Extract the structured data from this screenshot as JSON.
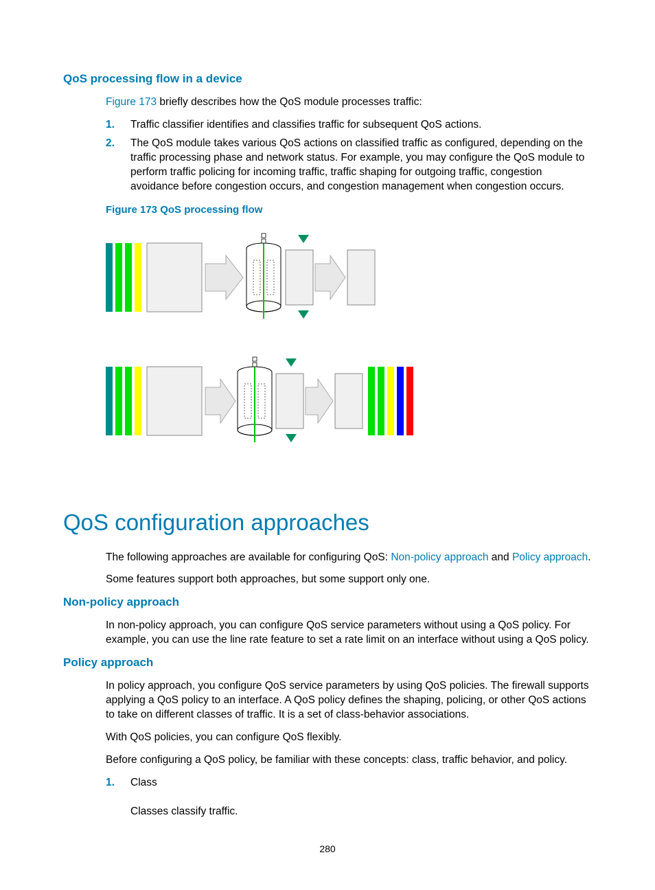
{
  "section1": {
    "heading": "QoS processing flow in a device",
    "intro_pre": " briefly describes how the QoS module processes traffic:",
    "fig_link": "Figure 173",
    "li1": "Traffic classifier identifies and classifies traffic for subsequent QoS actions.",
    "li2": "The QoS module takes various QoS actions on classified traffic as configured, depending on the traffic processing phase and network status. For example, you may configure the QoS module to perform traffic policing for incoming traffic, traffic shaping for outgoing traffic, congestion avoidance before congestion occurs, and congestion management when congestion occurs.",
    "fig_caption": "Figure 173 QoS processing flow"
  },
  "section2": {
    "heading": "QoS configuration approaches",
    "intro_a": "The following approaches are available for configuring QoS: ",
    "link1": "Non-policy approach",
    "intro_b": " and ",
    "link2": "Policy approach",
    "intro_c": ".",
    "p2": "Some features support both approaches, but some support only one."
  },
  "section3": {
    "heading": "Non-policy approach",
    "p1": "In non-policy approach, you can configure QoS service parameters without using a QoS policy. For example, you can use the line rate feature to set a rate limit on an interface without using a QoS policy."
  },
  "section4": {
    "heading": "Policy approach",
    "p1": "In policy approach, you configure QoS service parameters by using QoS policies. The firewall supports applying a QoS policy to an interface. A QoS policy defines the shaping, policing, or other QoS actions to take on different classes of traffic. It is a set of class-behavior associations.",
    "p2": "With QoS policies, you can configure QoS flexibly.",
    "p3": "Before configuring a QoS policy, be familiar with these concepts: class, traffic behavior, and policy.",
    "li1": "Class",
    "li1b": "Classes classify traffic."
  },
  "nums": {
    "n1": "1.",
    "n2": "2."
  },
  "page_num": "280",
  "colors": {
    "accent": "#007cb0",
    "bar_teal": "#008c8c",
    "bar_green": "#00e000",
    "bar_yellow": "#ffff00",
    "bar_red": "#ff0000",
    "bar_blue": "#0000ff"
  },
  "chart_data": {
    "type": "diagram",
    "description": "Two flow diagrams. Each shows colored input traffic bars (teal, green, green, yellow) entering a processing box, then an arrow to a cylindrical classifier/queue with green downward flow and triangle markers, then an arrow to output boxes. The second row additionally shows colored output bars (green, green, yellow, blue, red).",
    "rows": [
      {
        "input_bars": [
          "teal",
          "green",
          "green",
          "yellow"
        ],
        "stages": [
          "box",
          "arrow",
          "cylinder",
          "box",
          "arrow",
          "box"
        ],
        "output_bars": []
      },
      {
        "input_bars": [
          "teal",
          "green",
          "green",
          "yellow"
        ],
        "stages": [
          "box",
          "arrow",
          "cylinder",
          "box",
          "arrow",
          "box"
        ],
        "output_bars": [
          "green",
          "green",
          "yellow",
          "blue",
          "red"
        ]
      }
    ]
  }
}
